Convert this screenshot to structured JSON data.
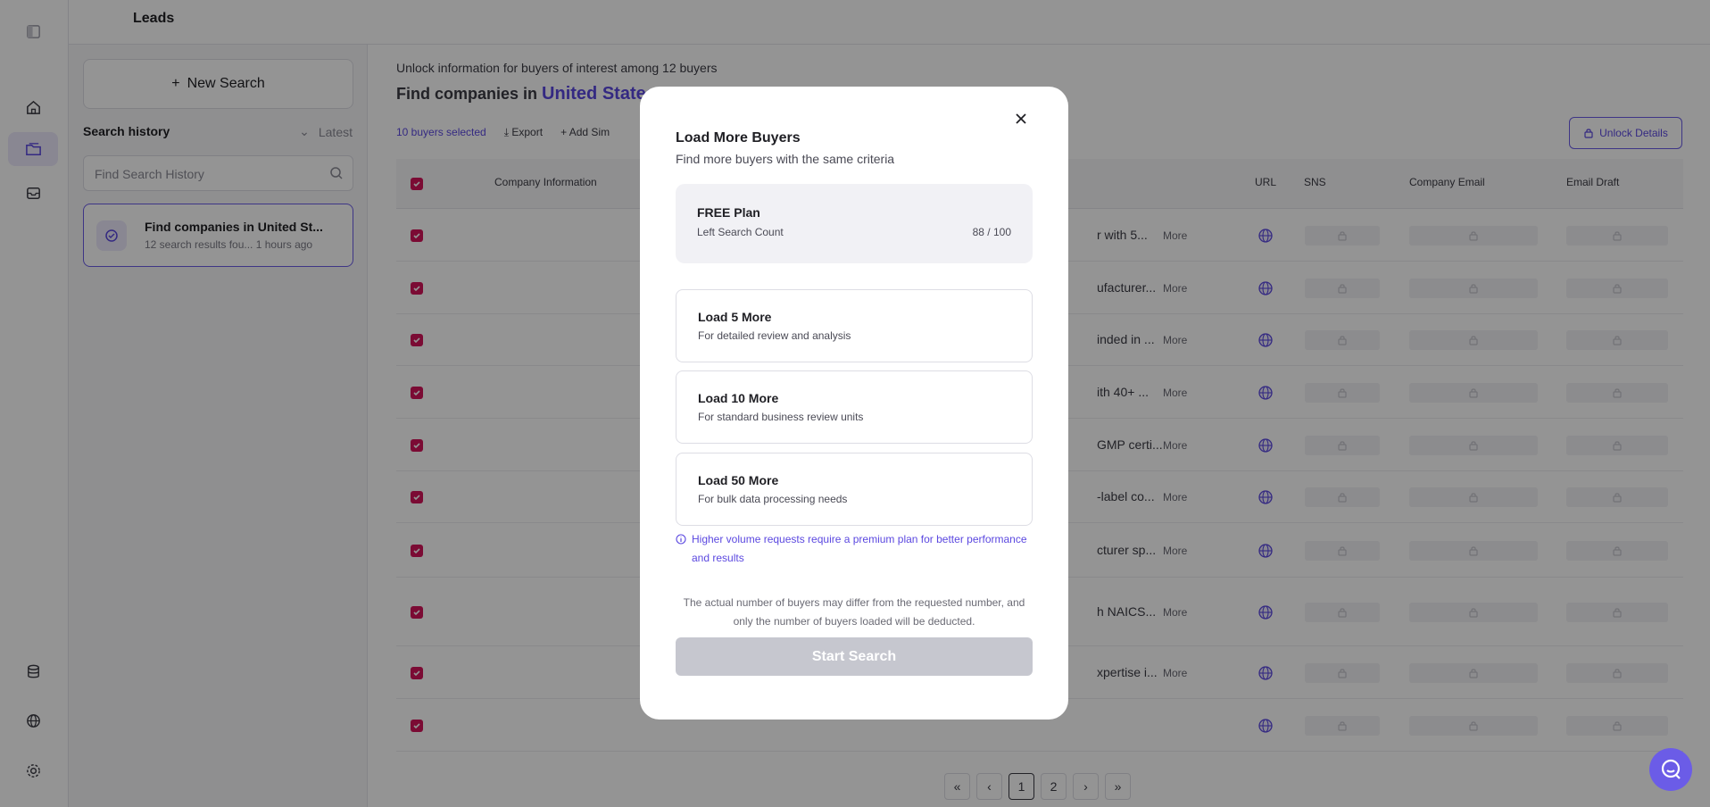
{
  "app": {
    "page_title": "Leads"
  },
  "sidebar": {
    "new_search_label": "New Search",
    "history_title": "Search history",
    "sort_label": "Latest",
    "search_placeholder": "Find Search History",
    "history_items": [
      {
        "title": "Find companies in United St...",
        "subtitle": "12 search results fou...   1 hours ago"
      }
    ]
  },
  "main": {
    "unlock_info": "Unlock information for buyers of interest among 12 buyers",
    "find_prefix": "Find companies in",
    "find_location": "United States",
    "selected_label": "10 buyers selected",
    "export_label": "Export",
    "add_similar_label": "Add Sim",
    "unlock_button": "Unlock Details",
    "columns": [
      "Company Information",
      "URL",
      "SNS",
      "Company Email",
      "Email Draft"
    ],
    "row_descriptions": [
      "r with 5...",
      "ufacturer...",
      "inded in ...",
      "ith 40+ ...",
      "GMP certi...",
      "-label co...",
      "cturer sp...",
      "h NAICS...",
      "xpertise i...",
      ""
    ],
    "more_label": "More",
    "pagination": [
      "«",
      "‹",
      "1",
      "2",
      "›",
      "»"
    ]
  },
  "modal": {
    "title": "Load More Buyers",
    "subtitle": "Find more buyers with the same criteria",
    "plan_name": "FREE Plan",
    "plan_count_label": "Left Search Count",
    "plan_count": "88 / 100",
    "options": [
      {
        "title": "Load 5 More",
        "desc": "For detailed review and analysis"
      },
      {
        "title": "Load 10 More",
        "desc": "For standard business review units"
      },
      {
        "title": "Load 50 More",
        "desc": "For bulk data processing needs"
      }
    ],
    "note": "Higher volume requests require a premium plan for better performance and results",
    "disclaimer": "The actual number of buyers may differ from the requested number, and only the number of buyers loaded will be deducted.",
    "start_button": "Start Search"
  },
  "colors": {
    "accent": "#5b48e0",
    "checkbox": "#d4145a",
    "disabled_button": "#c6c7cf"
  },
  "icons": [
    "sidebar-toggle-icon",
    "home-icon",
    "folder-icon",
    "inbox-icon",
    "database-icon",
    "globe-icon",
    "gear-icon",
    "chat-icon",
    "close-icon",
    "lock-icon",
    "info-icon"
  ]
}
